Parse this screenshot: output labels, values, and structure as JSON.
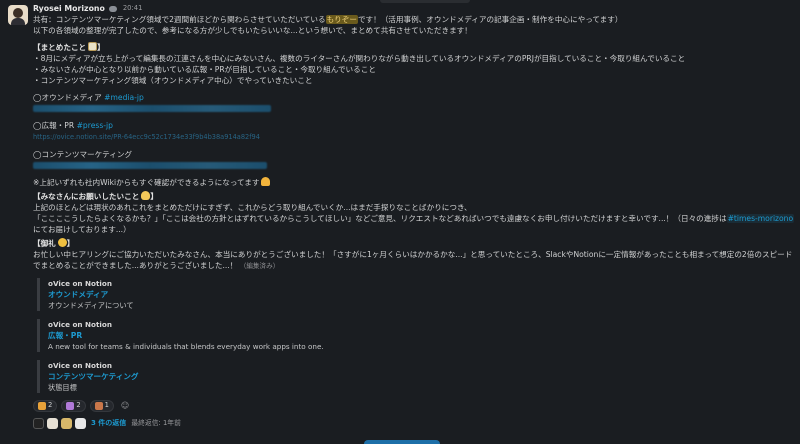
{
  "message": {
    "author": "Ryosei Morizono",
    "time": "20:41",
    "greet_pre": "共有：コンテンツマーケティング領域で2週間前ほどから関わらさせていただいている",
    "greet_hl": "もりぞー",
    "greet_post": "です！（活用事例、オウンドメディアの記事企画・制作を中心にやってます）",
    "greet_line2": "以下の各領域の整理が完了したので、参考になる方が少しでもいたらいいな...という想いで、まとめて共有させていただきます！",
    "summary_heading": "【まとめたこと",
    "summary_heading_end": "】",
    "summary_items": [
      "・8月にメディアが立ち上がって編集長の江連さんを中心にみないさん、複数のライターさんが関わりながら動き出しているオウンドメディアのPRJが目指していること・今取り組んでいること",
      "・みないさんが中心となり以前から動いている広報・PRが目指していること・今取り組んでいること",
      "・コンテンツマーケティング領域（オウンドメディア中心）でやっていきたいこと"
    ],
    "section1_label": "◯オウンドメディア",
    "section1_channel": "#media-jp",
    "section2_label": "◯広報・PR",
    "section2_channel": "#press-jp",
    "section2_url": "https://ovice.notion.site/PR-64ecc9c52c1734e33f9b4b38a914a82f94",
    "section3_label": "◯コンテンツマーケティング",
    "wiki_note": "※上記いずれも社内Wikiからもすぐ確認ができるようになってます",
    "request_heading": "【みなさんにお願いしたいこと",
    "request_heading_end": "】",
    "request_line1": "上記のほとんどは現状のあれこれをまとめただけにすぎず、これからどう取り組んでいくか...はまだ手探りなことばかりにつき、",
    "request_line2_pre": "「ここここうしたらよくなるかも？」「ここは会社の方針とはずれているからこうしてほしい」などご意見、リクエストなどあればいつでも遠慮なくお申し付けいただけますと幸いです...！（日々の進捗は",
    "request_channel": "#times-morizono",
    "request_line3": "にてお届けしております...）",
    "thanks_heading": "【御礼",
    "thanks_heading_end": "】",
    "thanks_line1": "お忙しい中ヒアリングにご協力いただいたみなさん、本当にありがとうございました！「さすがに1ヶ月くらいはかかるかな...」と思っていたところ、SlackやNotionに一定情報があったことも相まって想定の2倍のスピード",
    "thanks_line2": "でまとめることができました...ありがとうございました...！",
    "edited_label": "（編集済み）"
  },
  "attachments": [
    {
      "source": "oVice on Notion",
      "title": "オウンドメディア",
      "desc": "オウンドメディアについて"
    },
    {
      "source": "oVice on Notion",
      "title": "広報・PR",
      "desc": "A new tool for teams & individuals that blends everyday work apps into one."
    },
    {
      "source": "oVice on Notion",
      "title": "コンテンツマーケティング",
      "desc": "状態目標"
    }
  ],
  "reactions": [
    {
      "icon": "party-popper-icon",
      "count": "2",
      "color": "#e8a23a"
    },
    {
      "icon": "sparkle-grid-icon",
      "count": "2",
      "color": "#b07ad8"
    },
    {
      "icon": "books-icon",
      "count": "1",
      "color": "#c9774a"
    }
  ],
  "thread": {
    "count_label": "3 件の返信",
    "last_reply": "最終返信: 1年前",
    "avatar_colors": [
      "#222222",
      "#e6e0d4",
      "#d8b86a",
      "#e8e8e8"
    ]
  },
  "colors": {
    "background": "#1a1d21",
    "link": "#1d9bd1",
    "highlight": "#6a5a1c"
  }
}
